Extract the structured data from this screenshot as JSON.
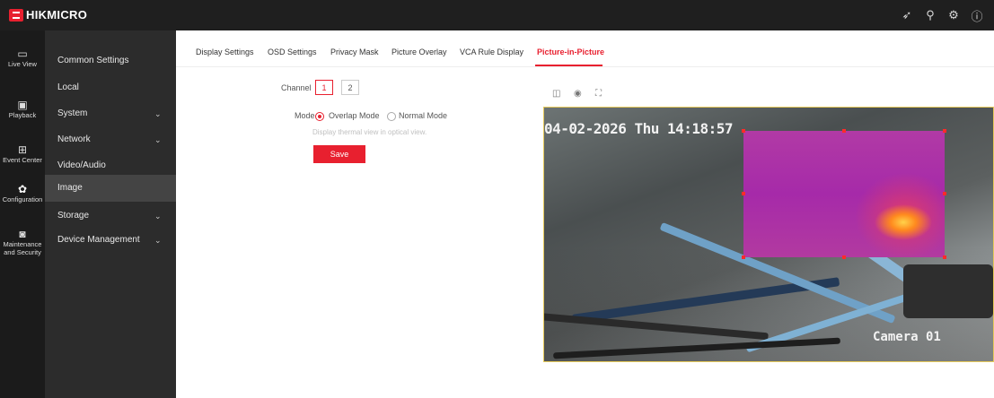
{
  "brand": {
    "name": "HIKMICRO"
  },
  "topbar": {
    "icons": [
      "send-icon",
      "search-icon",
      "settings-icon",
      "info-icon"
    ]
  },
  "rail": [
    {
      "key": "live-view",
      "icon": "monitor-icon",
      "label": "Live View"
    },
    {
      "key": "playback",
      "icon": "play-icon",
      "label": "Playback"
    },
    {
      "key": "event-center",
      "icon": "grid-icon",
      "label": "Event Center"
    },
    {
      "key": "configuration",
      "icon": "gear-icon",
      "label": "Configuration",
      "active": true
    },
    {
      "key": "maintenance",
      "icon": "shield-icon",
      "label_line1": "Maintenance",
      "label_line2": "and Security"
    }
  ],
  "menu": [
    {
      "label": "Common Settings"
    },
    {
      "label": "Local"
    },
    {
      "label": "System",
      "expandable": true
    },
    {
      "label": "Network",
      "expandable": true
    },
    {
      "label": "Video/Audio"
    },
    {
      "label": "Image",
      "active": true
    },
    {
      "label": "Storage",
      "expandable": true
    },
    {
      "label": "Device Management",
      "expandable": true
    }
  ],
  "tabs": [
    {
      "label": "Display Settings"
    },
    {
      "label": "OSD Settings"
    },
    {
      "label": "Privacy Mask"
    },
    {
      "label": "Picture Overlay"
    },
    {
      "label": "VCA Rule Display"
    },
    {
      "label": "Picture-in-Picture",
      "active": true
    }
  ],
  "form": {
    "channel_label": "Channel",
    "channels": [
      "1",
      "2"
    ],
    "selected_channel": "1",
    "mode_label": "Mode",
    "modes": [
      "Overlap Mode",
      "Normal Mode"
    ],
    "selected_mode": "Overlap Mode",
    "hint": "Display thermal view in optical view.",
    "save_label": "Save"
  },
  "player": {
    "toolbar_icons": [
      "camera-icon",
      "record-icon",
      "fullscreen-icon"
    ],
    "osd_time": "04-02-2026 Thu 14:18:57",
    "osd_camera": "Camera 01"
  },
  "colors": {
    "accent": "#e8202f",
    "topbar": "#1f1f1f",
    "rail": "#1b1b1b",
    "menu": "#2c2c2c",
    "menu_active": "#444444"
  }
}
